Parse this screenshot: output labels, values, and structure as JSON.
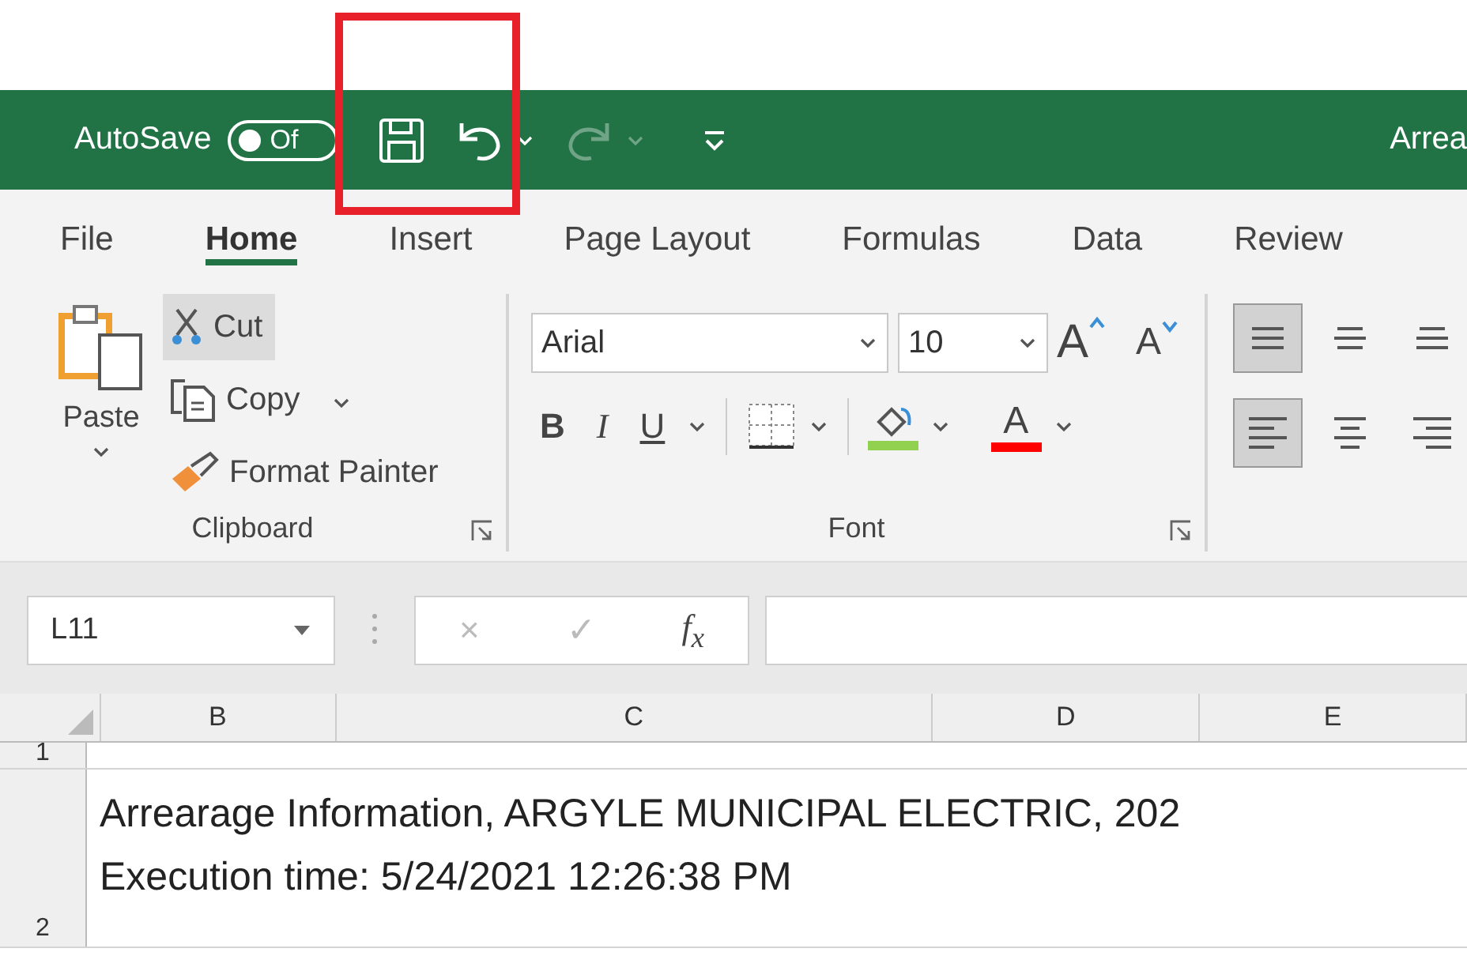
{
  "annotation": {
    "kind": "highlight"
  },
  "title_bar": {
    "autosave_label": "AutoSave",
    "autosave_toggle": {
      "label": "Of",
      "on": false
    },
    "title": "Arrea"
  },
  "quick_access": [
    {
      "kind": "save",
      "disabled": false
    },
    {
      "kind": "undo",
      "disabled": false
    },
    {
      "kind": "redo",
      "disabled": true
    },
    {
      "kind": "customize",
      "disabled": false
    }
  ],
  "tabs": [
    {
      "label": "File",
      "selected": false
    },
    {
      "label": "Home",
      "selected": true
    },
    {
      "label": "Insert",
      "selected": false
    },
    {
      "label": "Page Layout",
      "selected": false
    },
    {
      "label": "Formulas",
      "selected": false
    },
    {
      "label": "Data",
      "selected": false
    },
    {
      "label": "Review",
      "selected": false
    }
  ],
  "clipboard": {
    "paste": "Paste",
    "cut": {
      "label": "Cut",
      "highlighted": true
    },
    "copy": "Copy",
    "format_painter": "Format Painter",
    "group_label": "Clipboard"
  },
  "font": {
    "name": "Arial",
    "size": "10",
    "grow": "A",
    "shrink": "A",
    "bold": "B",
    "italic": "I",
    "underline": "U",
    "fill_color": {
      "color": "#92d050"
    },
    "font_color": {
      "label": "A",
      "color": "#ff0000"
    },
    "group_label": "Font"
  },
  "alignment": [
    [
      {
        "kind": "top",
        "selected": true
      },
      {
        "kind": "middle",
        "selected": false
      },
      {
        "kind": "bottom",
        "selected": false
      }
    ],
    [
      {
        "kind": "left",
        "selected": true
      },
      {
        "kind": "center",
        "selected": false
      },
      {
        "kind": "right",
        "selected": false
      }
    ]
  ],
  "formula_bar": {
    "name_box": "L11",
    "cancel": "×",
    "enter": "✓",
    "function": "f$_{x}$"
  },
  "sheet": {
    "columns": [
      "B",
      "C",
      "D",
      "E"
    ],
    "rows": [
      {
        "header": "1"
      },
      {
        "header": "2",
        "lines": [
          "Arrearage Information, ARGYLE MUNICIPAL ELECTRIC, 202",
          "Execution time: 5/24/2021 12:26:38 PM"
        ]
      }
    ]
  }
}
